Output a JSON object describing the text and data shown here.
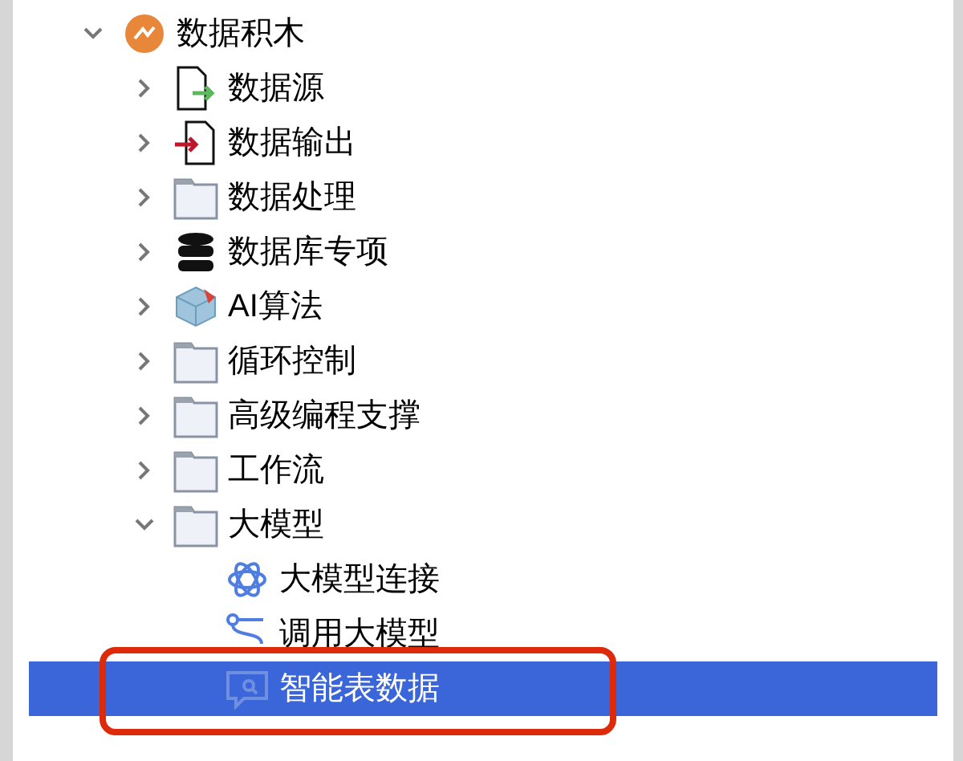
{
  "tree": [
    {
      "label": "数据积木",
      "kind": "logo",
      "expanded": true,
      "selected": false,
      "children": [
        {
          "label": "数据源",
          "kind": "file-in",
          "expanded": false,
          "selected": false
        },
        {
          "label": "数据输出",
          "kind": "file-out",
          "expanded": false,
          "selected": false
        },
        {
          "label": "数据处理",
          "kind": "folder",
          "expanded": false,
          "selected": false
        },
        {
          "label": "数据库专项",
          "kind": "database",
          "expanded": false,
          "selected": false
        },
        {
          "label": "AI算法",
          "kind": "cube",
          "expanded": false,
          "selected": false
        },
        {
          "label": "循环控制",
          "kind": "folder",
          "expanded": false,
          "selected": false
        },
        {
          "label": "高级编程支撑",
          "kind": "folder",
          "expanded": false,
          "selected": false
        },
        {
          "label": "工作流",
          "kind": "folder",
          "expanded": false,
          "selected": false
        },
        {
          "label": "大模型",
          "kind": "folder",
          "expanded": true,
          "selected": false,
          "children": [
            {
              "label": "大模型连接",
              "kind": "atom",
              "selected": false,
              "highlighted": false
            },
            {
              "label": "调用大模型",
              "kind": "flow",
              "selected": false,
              "highlighted": false
            },
            {
              "label": "智能表数据",
              "kind": "chat-search",
              "selected": true,
              "highlighted": true
            }
          ]
        }
      ]
    }
  ]
}
